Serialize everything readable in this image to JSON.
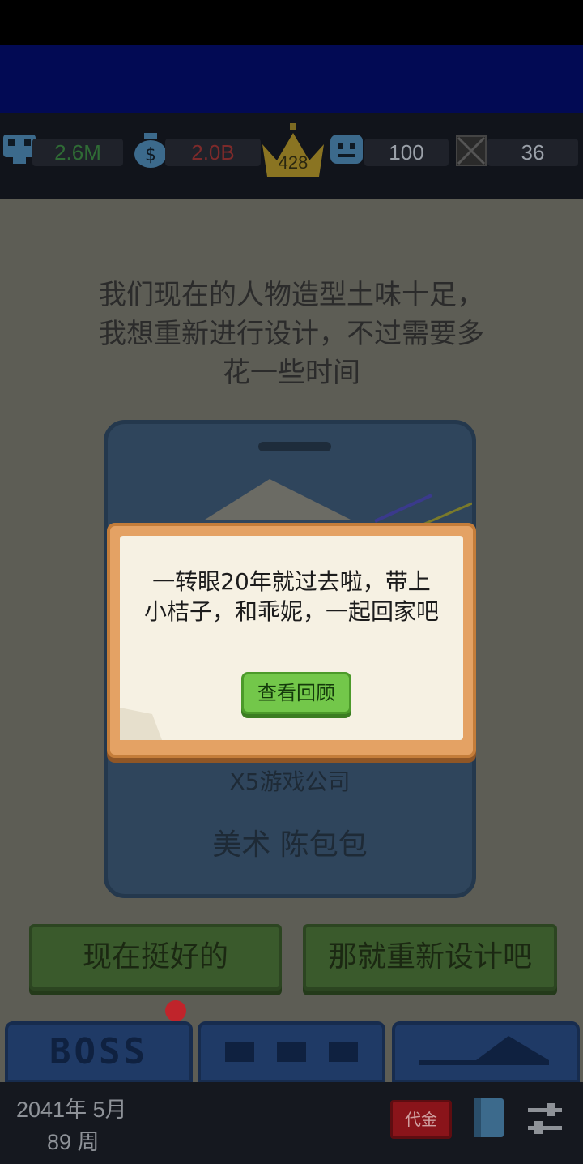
{
  "stats": {
    "employees_value": "2.6M",
    "money_value": "2.0B",
    "level_value": "428",
    "fans_value": "100",
    "items_value": "36"
  },
  "colors": {
    "employees_value": "#2f6b35",
    "money_value": "#7d2a2a"
  },
  "event": {
    "question": "我们现在的人物造型土味十足，我想重新进行设计，不过需要多花一些时间",
    "card_company": "X5游戏公司",
    "card_name": "美术 陈包包",
    "choice_left": "现在挺好的",
    "choice_right": "那就重新设计吧"
  },
  "tabs": {
    "boss_label": "BOSS"
  },
  "footer": {
    "date": "2041年 5月",
    "week": "89 周",
    "red_button_label": "代金"
  },
  "modal": {
    "message": "一转眼20年就过去啦，带上小桔子，和乖妮，一起回家吧",
    "button_label": "查看回顾"
  }
}
